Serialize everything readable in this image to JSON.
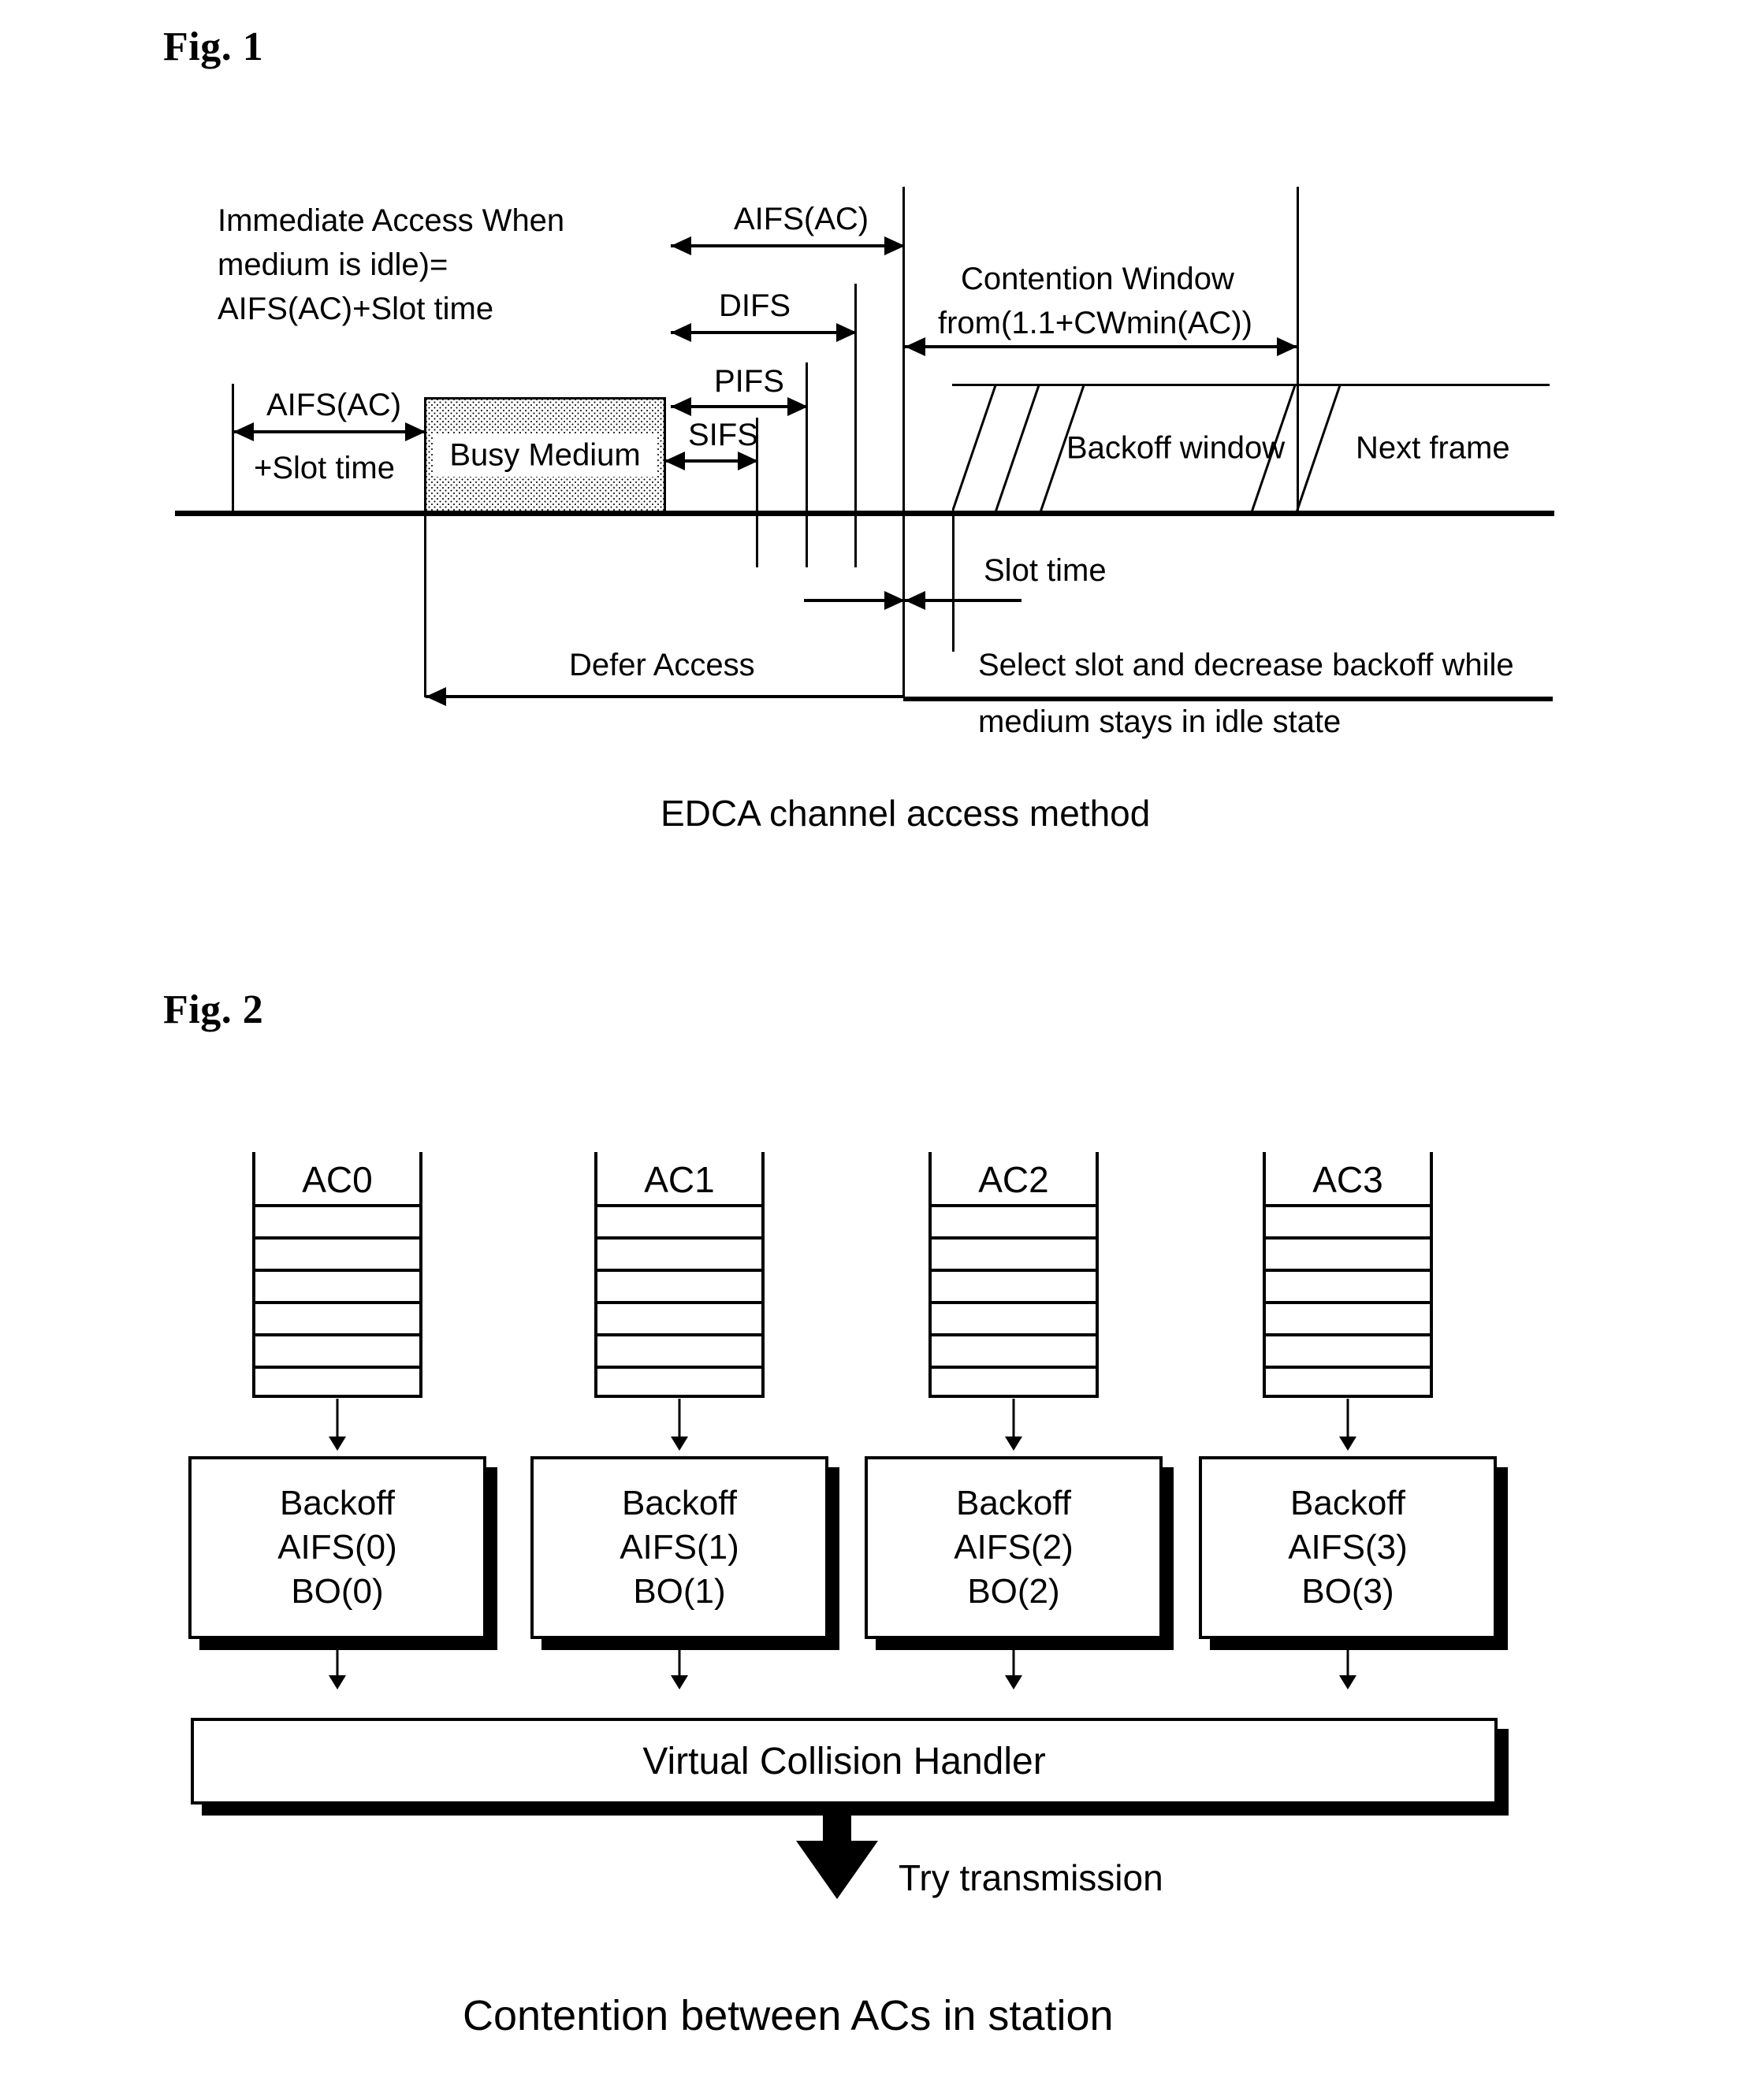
{
  "figures": [
    {
      "number": "Fig. 1",
      "caption": "EDCA channel access method",
      "labels": {
        "immediate_l1": "Immediate Access When",
        "immediate_l2": "medium is idle)=",
        "immediate_l3": "AIFS(AC)+Slot time",
        "aifs_left_l1": "AIFS(AC)",
        "aifs_left_l2": "+Slot time",
        "busy_medium": "Busy Medium",
        "aifs_top": "AIFS(AC)",
        "difs": "DIFS",
        "pifs": "PIFS",
        "sifs": "SIFS",
        "contention_l1": "Contention Window",
        "contention_l2": "from(1.1+CWmin(AC))",
        "backoff_window": "Backoff window",
        "next_frame": "Next frame",
        "slot_time": "Slot time",
        "defer_access": "Defer Access",
        "select_l1": "Select slot and decrease backoff while",
        "select_l2": "medium stays in idle state"
      }
    },
    {
      "number": "Fig. 2",
      "caption": "Contention between ACs in station",
      "queues": [
        {
          "label": "AC0"
        },
        {
          "label": "AC1"
        },
        {
          "label": "AC2"
        },
        {
          "label": "AC3"
        }
      ],
      "backoff_boxes": [
        {
          "line1": "Backoff",
          "line2": "AIFS(0)",
          "line3": "BO(0)"
        },
        {
          "line1": "Backoff",
          "line2": "AIFS(1)",
          "line3": "BO(1)"
        },
        {
          "line1": "Backoff",
          "line2": "AIFS(2)",
          "line3": "BO(2)"
        },
        {
          "line1": "Backoff",
          "line2": "AIFS(3)",
          "line3": "BO(3)"
        }
      ],
      "handler_label": "Virtual Collision Handler",
      "output_label": "Try transmission"
    }
  ]
}
